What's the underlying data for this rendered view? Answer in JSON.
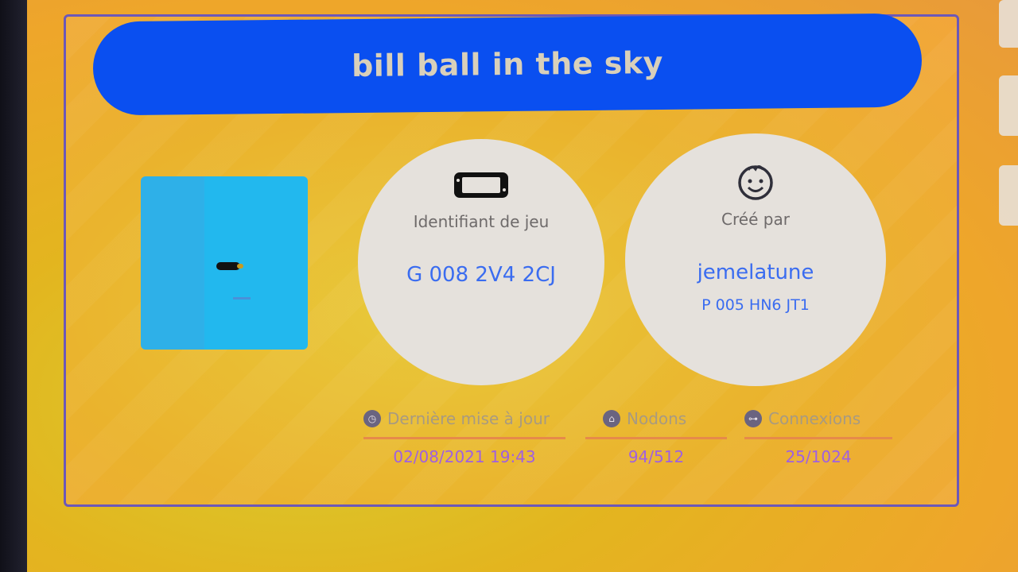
{
  "level": {
    "title": "bill ball in the sky"
  },
  "game_id": {
    "label": "Identifiant de jeu",
    "value": "G 008 2V4 2CJ",
    "icon": "console-icon"
  },
  "creator": {
    "label": "Créé par",
    "name": "jemelatune",
    "code": "P 005 HN6 JT1",
    "icon": "smiley-face-icon"
  },
  "stats": [
    {
      "label": "Dernière mise à jour",
      "value": "02/08/2021 19:43",
      "icon": "clock-icon"
    },
    {
      "label": "Nodons",
      "value": "94/512",
      "icon": "nodon-icon"
    },
    {
      "label": "Connexions",
      "value": "25/1024",
      "icon": "connection-icon"
    }
  ],
  "colors": {
    "title_bar": "#0a4ff0",
    "accent_blue": "#3a6cf0",
    "accent_purple": "#a060e0",
    "background": "#eab32d"
  }
}
